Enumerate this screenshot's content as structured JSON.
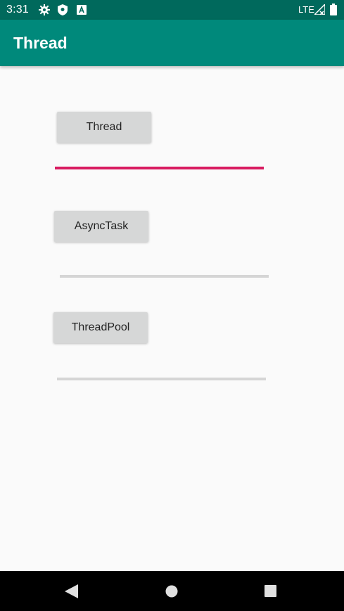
{
  "status_bar": {
    "time": "3:31",
    "network": "LTE",
    "icons": [
      "settings-icon",
      "shield-icon",
      "app-notification-icon",
      "signal-icon",
      "battery-icon"
    ]
  },
  "app_bar": {
    "title": "Thread"
  },
  "main": {
    "accent_color": "#d81b60",
    "track_color": "#d5d5d5",
    "buttons": [
      {
        "label": "Thread"
      },
      {
        "label": "AsyncTask"
      },
      {
        "label": "ThreadPool"
      }
    ],
    "progress_bars": [
      {
        "value": 1.0
      },
      {
        "value": 0.0
      },
      {
        "value": 0.0
      }
    ]
  },
  "nav_bar": {
    "icons": [
      "back-icon",
      "home-icon",
      "recents-icon"
    ]
  }
}
